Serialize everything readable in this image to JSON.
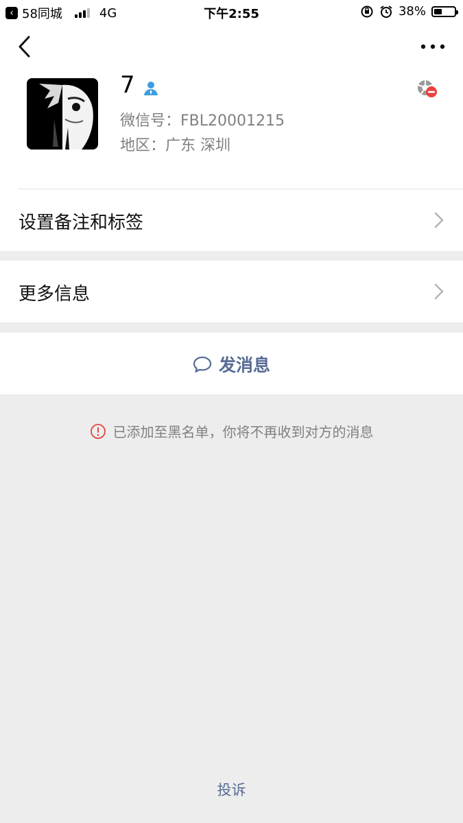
{
  "status_bar": {
    "back_app": "58同城",
    "network": "4G",
    "time": "下午2:55",
    "battery": "38%",
    "battery_level": 0.38
  },
  "profile": {
    "name": "7",
    "wechat_id": "微信号：FBL20001215",
    "region": "地区：广东 深圳"
  },
  "menu": {
    "remark_label": "设置备注和标签",
    "more_info_label": "更多信息"
  },
  "actions": {
    "send_message": "发消息"
  },
  "notice": {
    "blacklist": "已添加至黑名单，你将不再收到对方的消息"
  },
  "footer": {
    "report": "投诉"
  },
  "colors": {
    "link": "#576b95",
    "warning": "#e64340",
    "background": "#ededed"
  }
}
